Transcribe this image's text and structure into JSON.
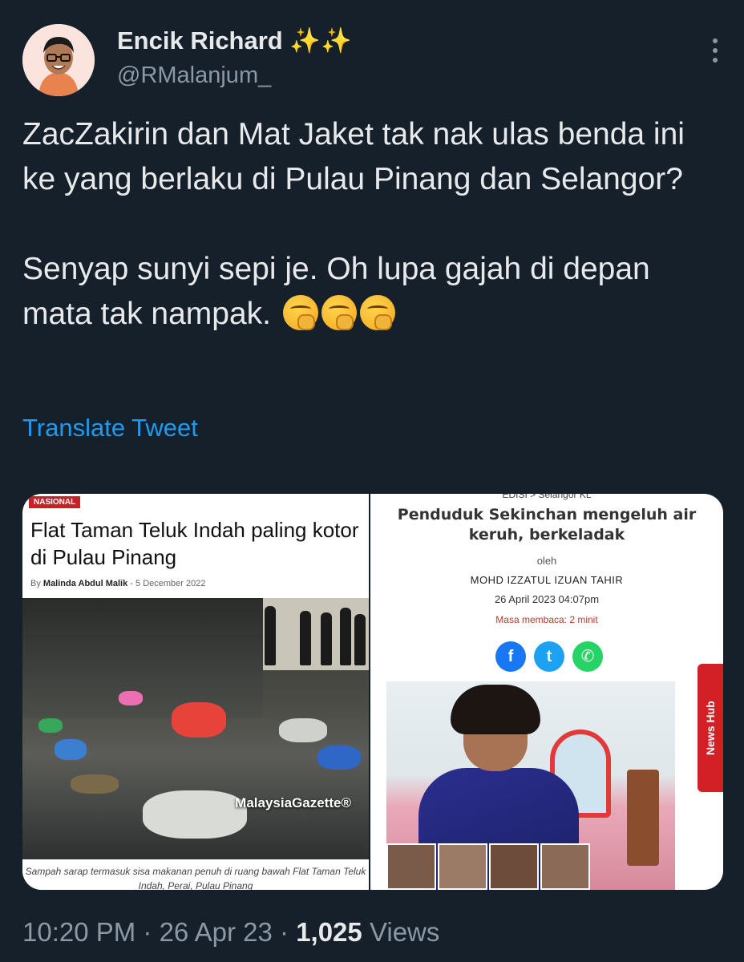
{
  "author": {
    "name": "Encik Richard",
    "name_suffix": "✨✨",
    "handle": "@RMalanjum_"
  },
  "tweet": {
    "line1": "ZacZakirin dan Mat Jaket tak nak ulas benda ini ke yang berlaku di Pulau Pinang dan Selangor?",
    "line2": "Senyap sunyi sepi je. Oh lupa gajah di depan mata tak nampak.",
    "emoji_name": "face-with-hand-over-mouth-icon",
    "translate_label": "Translate Tweet"
  },
  "media": {
    "left": {
      "badge": "NASIONAL",
      "title": "Flat Taman Teluk Indah paling kotor di Pulau Pinang",
      "byline_prefix": "By",
      "byline_author": "Malinda Abdul Malik",
      "byline_date": "- 5 December 2022",
      "watermark": "MalaysiaGazette®",
      "caption": "Sampah sarap termasuk sisa makanan penuh di ruang bawah Flat Taman Teluk Indah, Perai, Pulau Pinang"
    },
    "right": {
      "edisi": "EDISI > Selangor KL",
      "title": "Penduduk Sekinchan mengeluh air keruh, berkeladak",
      "oleh": "oleh",
      "author": "MOHD IZZATUL IZUAN TAHIR",
      "date": "26 April 2023 04:07pm",
      "read_time": "Masa membaca: 2 minit",
      "social": [
        {
          "icon": "facebook-icon",
          "glyph": "f",
          "color": "#1877f2"
        },
        {
          "icon": "twitter-icon",
          "glyph": "t",
          "color": "#1da1f2"
        },
        {
          "icon": "whatsapp-icon",
          "glyph": "✆",
          "color": "#25d366"
        }
      ],
      "news_hub": "News Hub"
    }
  },
  "meta": {
    "time": "10:20 PM",
    "sep1": " · ",
    "date": "26 Apr 23",
    "sep2": " · ",
    "views_count": "1,025",
    "views_label": " Views"
  },
  "colors": {
    "background": "#15202b",
    "link": "#1d9bf0",
    "secondary_text": "#8b98a5"
  }
}
